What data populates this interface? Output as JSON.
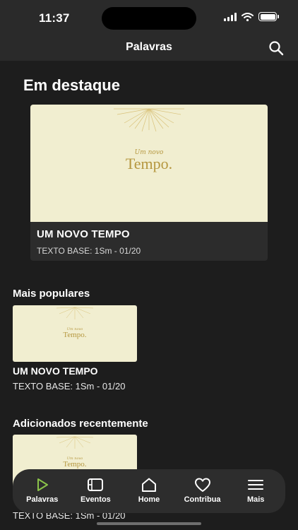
{
  "status": {
    "time": "11:37"
  },
  "header": {
    "title": "Palavras"
  },
  "featured": {
    "section_title": "Em destaque",
    "art_small": "Um novo",
    "art_big": "Tempo.",
    "title": "UM NOVO TEMPO",
    "subtitle": "TEXTO BASE: 1Sm - 01/20"
  },
  "popular": {
    "section_title": "Mais populares",
    "art_small": "Um novo",
    "art_big": "Tempo.",
    "title": "UM NOVO TEMPO",
    "subtitle": "TEXTO BASE: 1Sm - 01/20"
  },
  "recent": {
    "section_title": "Adicionados recentemente",
    "art_small": "Um novo",
    "art_big": "Tempo.",
    "subtitle": "TEXTO BASE: 1Sm - 01/20"
  },
  "tabs": [
    {
      "label": "Palavras",
      "icon": "play-icon",
      "active": true
    },
    {
      "label": "Eventos",
      "icon": "film-icon"
    },
    {
      "label": "Home",
      "icon": "home-icon"
    },
    {
      "label": "Contribua",
      "icon": "heart-icon"
    },
    {
      "label": "Mais",
      "icon": "menu-icon"
    }
  ],
  "colors": {
    "accent": "#8bc34a",
    "artwork_bg": "#f1eed0",
    "artwork_gold": "#b5973f",
    "background": "#1d1d1d"
  }
}
